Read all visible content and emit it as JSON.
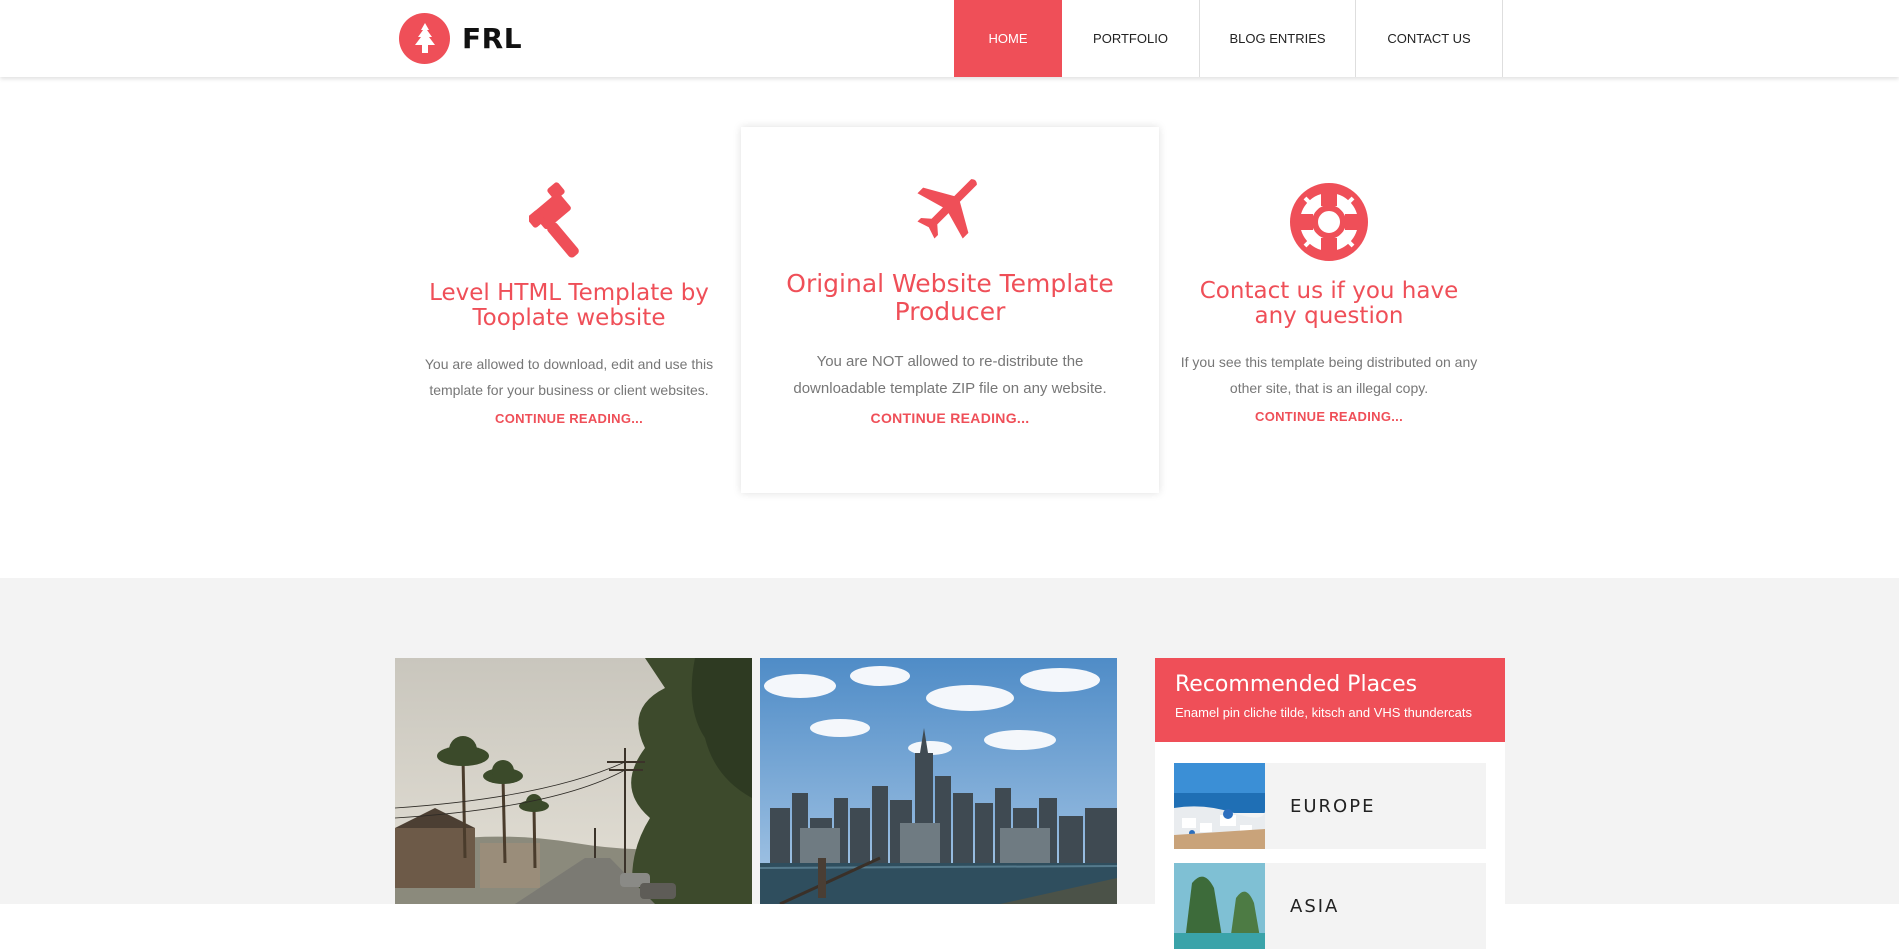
{
  "brand": {
    "name": "FRL",
    "accent": "#ef4f58"
  },
  "nav": [
    {
      "label": "HOME",
      "active": true
    },
    {
      "label": "PORTFOLIO",
      "active": false
    },
    {
      "label": "BLOG ENTRIES",
      "active": false
    },
    {
      "label": "CONTACT US",
      "active": false
    }
  ],
  "features": [
    {
      "icon": "gavel-icon",
      "title": "Level HTML Template by Tooplate website",
      "text": "You are allowed to download, edit and use this template for your business or client websites.",
      "link": "CONTINUE READING..."
    },
    {
      "icon": "airplane-icon",
      "title": "Original Website Template Producer",
      "text": "You are NOT allowed to re-distribute the downloadable template ZIP file on any website.",
      "link": "CONTINUE READING..."
    },
    {
      "icon": "life-ring-icon",
      "title": "Contact us if you have any question",
      "text": "If you see this template being distributed on any other site, that is an illegal copy.",
      "link": "CONTINUE READING..."
    }
  ],
  "gallery": {
    "photos": [
      "palm-street-photo",
      "city-skyline-photo"
    ]
  },
  "recommended": {
    "title": "Recommended Places",
    "subtitle": "Enamel pin cliche tilde, kitsch and VHS thundercats",
    "places": [
      {
        "name": "EUROPE"
      },
      {
        "name": "ASIA"
      }
    ]
  }
}
